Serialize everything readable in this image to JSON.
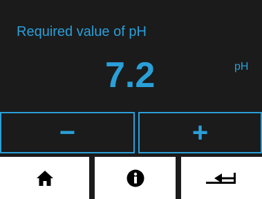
{
  "header": {
    "title": "Required value of pH"
  },
  "reading": {
    "value": "7.2",
    "unit": "pH"
  },
  "controls": {
    "decrement_label": "−",
    "increment_label": "+"
  },
  "nav": {
    "home_icon": "home-icon",
    "info_icon": "info-icon",
    "back_icon": "return-arrow-icon"
  },
  "colors": {
    "background": "#1b1b1b",
    "accent": "#2a9fd8",
    "nav_button": "#ffffff",
    "icon": "#000000"
  }
}
